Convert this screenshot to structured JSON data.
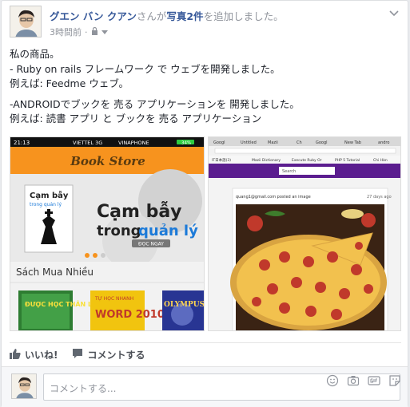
{
  "post": {
    "author": "グエン バン クアン",
    "headline_mid": "さんが",
    "headline_link": "写真2件",
    "headline_end": "を追加しました。",
    "time": "3時間前",
    "privacy_sep": "·",
    "lines": [
      "私の商品。",
      "- Ruby on rails フレームワーク で ウェブを開発しました。",
      "例えば: Feedme ウェブ。",
      "",
      "-ANDROIDでブックを 売る アプリケーションを 開発しました。",
      "例えば: 読書 アプリ と ブックを 売る アプリケーション"
    ]
  },
  "photo1": {
    "status_time": "21:13",
    "carrier1": "VIETTEL 3G",
    "carrier2": "VINAPHONE",
    "battery": "34%",
    "store_title": "Book Store",
    "banner_line1": "Cạm bẫy",
    "banner_line2": "trong",
    "banner_line3": "quản lý",
    "banner_btn": "ĐỌC NGAY",
    "book_title_small": "Cạm bẫy",
    "book_sub_small": "trong quản lý",
    "section": "Sách Mua Nhiều",
    "book1": "ĐƯỢC HỌC THÂN LUẬN",
    "book2_top": "TỰ HỌC NHANH",
    "book2": "WORD 2010",
    "book3": "OLYMPUS"
  },
  "photo2": {
    "tabs": [
      "Googl",
      "Untitled",
      "Mazii",
      "Ch",
      "Googl",
      "New Tab",
      "andro"
    ],
    "bookmarks": [
      "IT日本語(3)",
      "Mazii Dictionary",
      "Execute Ruby Or",
      "PHP 5 Tutorial",
      "Chi Hàn"
    ],
    "search_btn": "Search",
    "poster": "quang1@gmail.com posted an image",
    "ago": "27 days ago"
  },
  "actions": {
    "like": "いいね!",
    "comment": "コメントする"
  },
  "composer": {
    "placeholder": "コメントする..."
  },
  "colors": {
    "link": "#365899",
    "store_header": "#f7931e",
    "browser_bar": "#5b1d8f"
  }
}
